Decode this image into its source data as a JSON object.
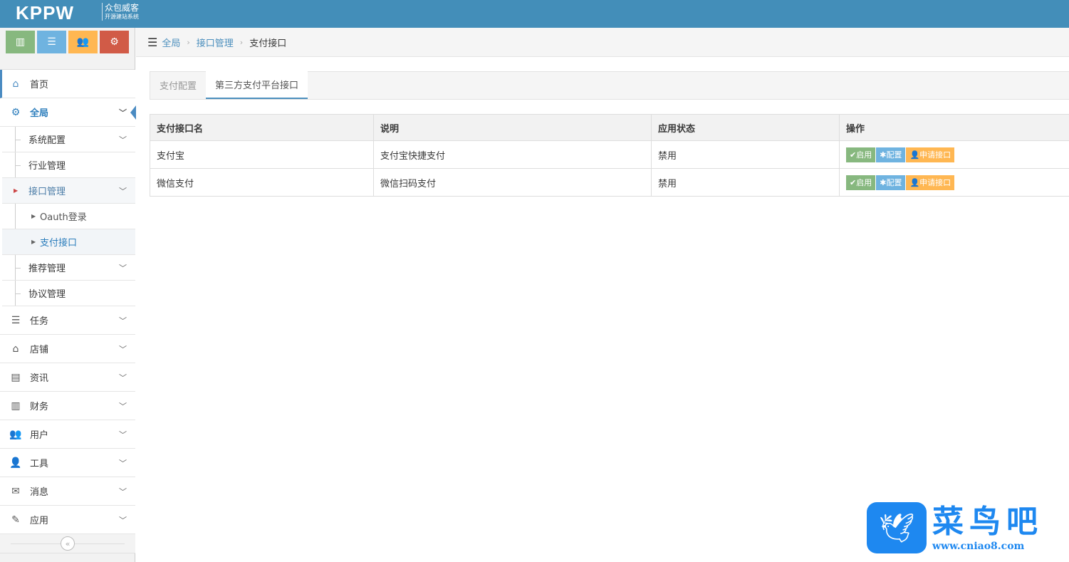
{
  "header": {
    "logo": "KPPW",
    "logo_sub1": "众包威客",
    "logo_sub2": "开源建站系统"
  },
  "shortcuts": [
    {
      "icon": "chart-icon",
      "color": "#87b87f"
    },
    {
      "icon": "list-icon",
      "color": "#6fb3e0"
    },
    {
      "icon": "users-icon",
      "color": "#ffb752"
    },
    {
      "icon": "cogs-icon",
      "color": "#d15b47"
    }
  ],
  "breadcrumb": {
    "items": [
      "全局",
      "接口管理",
      "支付接口"
    ]
  },
  "sidebar": {
    "home": "首页",
    "global": "全局",
    "sub": {
      "sys": "系统配置",
      "industry": "行业管理",
      "iface": "接口管理",
      "oauth": "Oauth登录",
      "pay": "支付接口",
      "recommend": "推荐管理",
      "agreement": "协议管理"
    },
    "items": [
      "任务",
      "店铺",
      "资讯",
      "财务",
      "用户",
      "工具",
      "消息",
      "应用"
    ]
  },
  "tabs": [
    "支付配置",
    "第三方支付平台接口"
  ],
  "table": {
    "headers": [
      "支付接口名",
      "说明",
      "应用状态",
      "操作"
    ],
    "rows": [
      {
        "name": "支付宝",
        "desc": "支付宝快捷支付",
        "status": "禁用"
      },
      {
        "name": "微信支付",
        "desc": "微信扫码支付",
        "status": "禁用"
      }
    ],
    "actions": {
      "enable": "启用",
      "config": "配置",
      "apply": "申请接口"
    }
  },
  "watermark": {
    "title": "菜鸟吧",
    "url": "www.cniao8.com"
  }
}
